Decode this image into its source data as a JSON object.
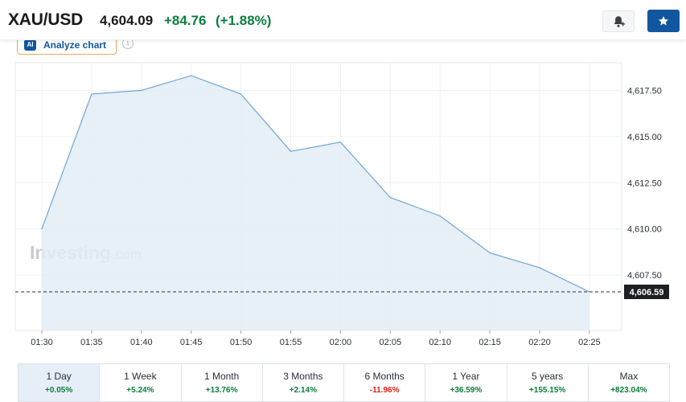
{
  "header": {
    "symbol": "XAU/USD",
    "price": "4,604.09",
    "change": "+84.76",
    "change_pct": "(+1.88%)",
    "alert_icon": "bell-plus-icon",
    "watchlist_icon": "star-icon"
  },
  "analyze": {
    "badge": "AI",
    "label": "Analyze chart",
    "info_glyph": "i"
  },
  "chart_data": {
    "type": "area",
    "x": [
      "01:30",
      "01:35",
      "01:40",
      "01:45",
      "01:50",
      "01:55",
      "02:00",
      "02:05",
      "02:10",
      "02:15",
      "02:20",
      "02:25"
    ],
    "y": [
      4610.0,
      4617.3,
      4617.5,
      4618.3,
      4617.3,
      4614.2,
      4614.7,
      4611.7,
      4610.7,
      4608.7,
      4607.9,
      4606.59
    ],
    "y_ticks": [
      "4,607.50",
      "4,610.00",
      "4,612.50",
      "4,615.00",
      "4,617.50"
    ],
    "ylim": [
      4604.5,
      4619.0
    ],
    "last_value": 4606.59,
    "last_label": "4,606.59",
    "watermark": {
      "brand": "Investing",
      "suffix": ".com"
    },
    "grid": true,
    "line_color": "#6ea6d4",
    "fill_color": "#e3ecf6"
  },
  "periods": [
    {
      "label": "1 Day",
      "change": "+0.05%",
      "positive": true,
      "active": true
    },
    {
      "label": "1 Week",
      "change": "+5.24%",
      "positive": true,
      "active": false
    },
    {
      "label": "1 Month",
      "change": "+13.76%",
      "positive": true,
      "active": false
    },
    {
      "label": "3 Months",
      "change": "+2.14%",
      "positive": true,
      "active": false
    },
    {
      "label": "6 Months",
      "change": "-11.96%",
      "positive": false,
      "active": false
    },
    {
      "label": "1 Year",
      "change": "+36.59%",
      "positive": true,
      "active": false
    },
    {
      "label": "5 years",
      "change": "+155.15%",
      "positive": true,
      "active": false
    },
    {
      "label": "Max",
      "change": "+823.04%",
      "positive": true,
      "active": false
    }
  ],
  "colors": {
    "positive": "#0a7e3e",
    "negative": "#d91e18",
    "accent": "#1256a0"
  }
}
